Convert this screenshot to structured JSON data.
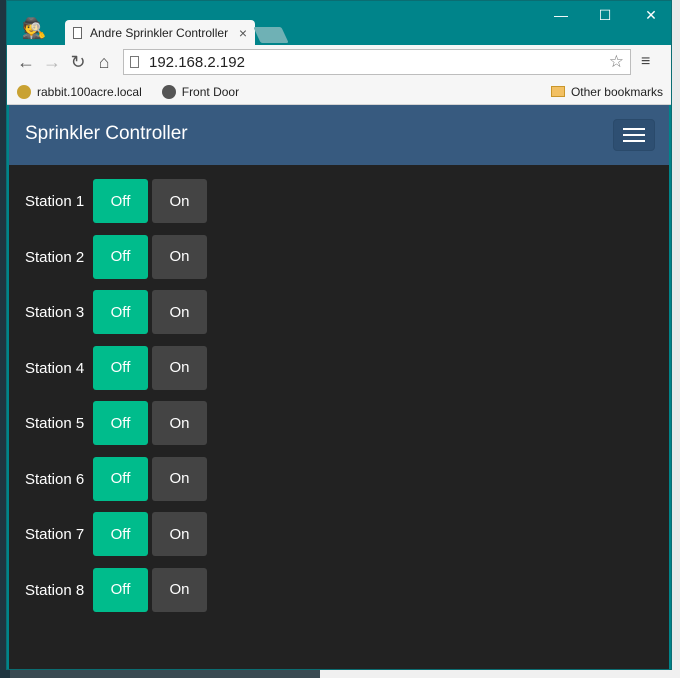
{
  "browser": {
    "tab_title": "Andre Sprinkler Controller",
    "tab_close": "×",
    "url": "192.168.2.192",
    "back_glyph": "←",
    "forward_glyph": "→",
    "reload_glyph": "↻",
    "home_glyph": "⌂",
    "star_glyph": "☆",
    "menu_glyph": "≡",
    "win_min": "—",
    "win_max": "☐",
    "win_close": "✕",
    "bookmarks": [
      {
        "label": "rabbit.100acre.local",
        "icon": "palm-tree-icon"
      },
      {
        "label": "Front Door",
        "icon": "camera-icon"
      }
    ],
    "other_bookmarks": "Other bookmarks"
  },
  "app": {
    "brand": "Sprinkler Controller",
    "stations": [
      {
        "label": "Station 1",
        "off": "Off",
        "on": "On"
      },
      {
        "label": "Station 2",
        "off": "Off",
        "on": "On"
      },
      {
        "label": "Station 3",
        "off": "Off",
        "on": "On"
      },
      {
        "label": "Station 4",
        "off": "Off",
        "on": "On"
      },
      {
        "label": "Station 5",
        "off": "Off",
        "on": "On"
      },
      {
        "label": "Station 6",
        "off": "Off",
        "on": "On"
      },
      {
        "label": "Station 7",
        "off": "Off",
        "on": "On"
      },
      {
        "label": "Station 8",
        "off": "Off",
        "on": "On"
      }
    ]
  },
  "colors": {
    "navbar": "#375a7f",
    "page_bg": "#222222",
    "off_active": "#00bc8c",
    "on_inactive": "#444444",
    "chrome_frame": "#00848a"
  }
}
